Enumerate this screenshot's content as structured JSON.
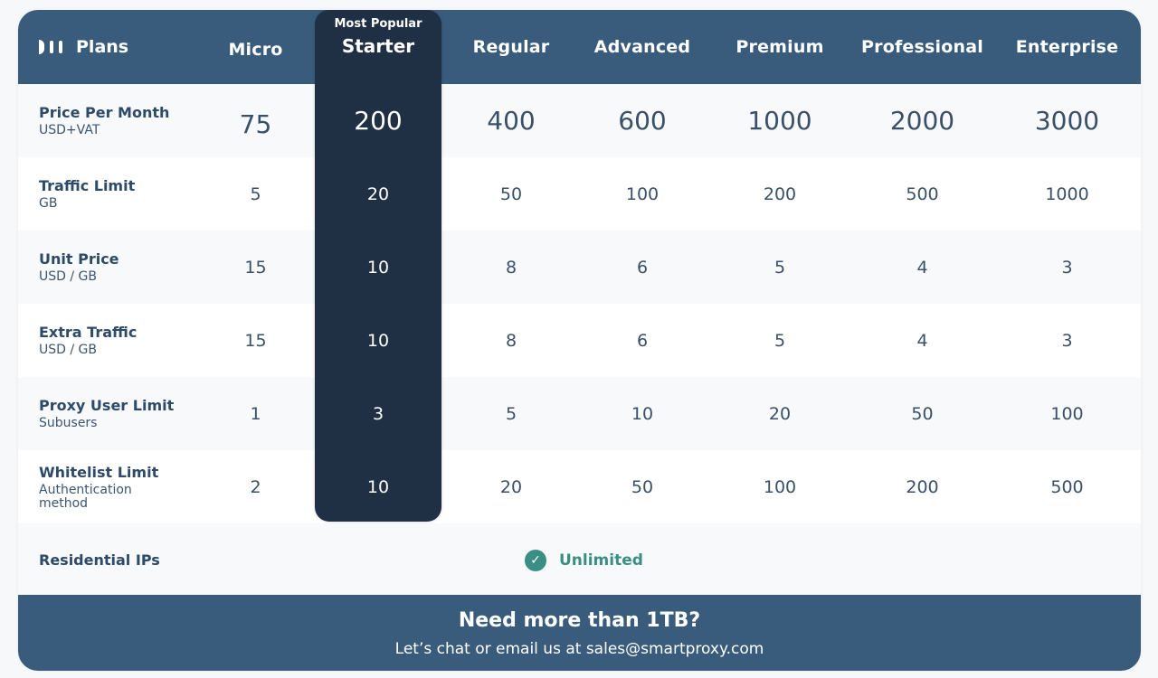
{
  "header": {
    "title": "Plans",
    "logo_icon": "smartproxy-logo-icon",
    "plans": [
      "Micro",
      "Starter",
      "Regular",
      "Advanced",
      "Premium",
      "Professional",
      "Enterprise"
    ],
    "popular_badge": "Most Popular"
  },
  "rows": [
    {
      "label": "Price Per Month",
      "sublabel": "USD+VAT",
      "values": [
        "75",
        "200",
        "400",
        "600",
        "1000",
        "2000",
        "3000"
      ]
    },
    {
      "label": "Traffic Limit",
      "sublabel": "GB",
      "values": [
        "5",
        "20",
        "50",
        "100",
        "200",
        "500",
        "1000"
      ]
    },
    {
      "label": "Unit Price",
      "sublabel": "USD / GB",
      "values": [
        "15",
        "10",
        "8",
        "6",
        "5",
        "4",
        "3"
      ]
    },
    {
      "label": "Extra Traffic",
      "sublabel": "USD / GB",
      "values": [
        "15",
        "10",
        "8",
        "6",
        "5",
        "4",
        "3"
      ]
    },
    {
      "label": "Proxy User Limit",
      "sublabel": "Subusers",
      "values": [
        "1",
        "3",
        "5",
        "10",
        "20",
        "50",
        "100"
      ]
    },
    {
      "label": "Whitelist Limit",
      "sublabel": "Authentication method",
      "values": [
        "2",
        "10",
        "20",
        "50",
        "100",
        "200",
        "500"
      ]
    }
  ],
  "residential": {
    "label": "Residential IPs",
    "value": "Unlimited",
    "icon": "check-circle-icon"
  },
  "footer": {
    "heading": "Need more than 1TB?",
    "text": "Let’s chat or email us at sales@smartproxy.com"
  },
  "colors": {
    "header_bg": "#3a5c7c",
    "popular_bg": "#1f2f44",
    "accent_green": "#3a8f85",
    "text_dark": "#2d4a68"
  }
}
